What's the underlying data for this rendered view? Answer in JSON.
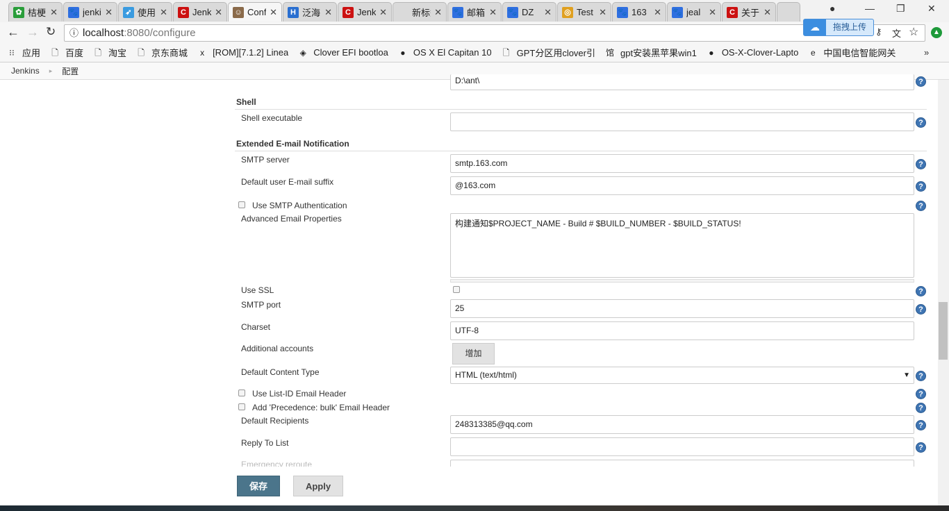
{
  "browser": {
    "tabs": [
      {
        "title": "桔梗",
        "color": "#2a9d3a",
        "glyph": "✿"
      },
      {
        "title": "jenkins",
        "color": "#2f6fe0",
        "glyph": "🐾"
      },
      {
        "title": "使用",
        "color": "#3a9be0",
        "glyph": "➶"
      },
      {
        "title": "Jenkins",
        "color": "#cc1111",
        "glyph": "C"
      },
      {
        "title": "Configure",
        "color": "#8a6a4a",
        "glyph": "☺",
        "active": true
      },
      {
        "title": "泛海",
        "color": "#2a6fd0",
        "glyph": "H"
      },
      {
        "title": "Jenkins",
        "color": "#cc1111",
        "glyph": "C"
      },
      {
        "title": "新标签页",
        "color": "",
        "glyph": ""
      },
      {
        "title": "邮箱",
        "color": "#2f6fe0",
        "glyph": "🐾"
      },
      {
        "title": "DZ",
        "color": "#2f6fe0",
        "glyph": "🐾"
      },
      {
        "title": "Test",
        "color": "#e0a020",
        "glyph": "◎"
      },
      {
        "title": "163",
        "color": "#2f6fe0",
        "glyph": "🐾"
      },
      {
        "title": "jeal",
        "color": "#2f6fe0",
        "glyph": "🐾"
      },
      {
        "title": "关于",
        "color": "#cc1111",
        "glyph": "C"
      }
    ],
    "url_host": "localhost",
    "url_rest": ":8080/configure",
    "baidu_upload": "拖拽上传",
    "bookmarks": [
      {
        "label": "应用",
        "icon": "apps-icon"
      },
      {
        "label": "百度",
        "icon": "page-icon"
      },
      {
        "label": "淘宝",
        "icon": "page-icon"
      },
      {
        "label": "京东商城",
        "icon": "page-icon"
      },
      {
        "label": "[ROM][7.1.2] Linea",
        "icon": "xda-icon"
      },
      {
        "label": "Clover EFI bootloa",
        "icon": "clover-icon"
      },
      {
        "label": "OS X El Capitan 10",
        "icon": "apple-icon"
      },
      {
        "label": "GPT分区用clover引",
        "icon": "page-icon"
      },
      {
        "label": "gpt安装黑苹果win1",
        "icon": "guan-icon"
      },
      {
        "label": "OS-X-Clover-Lapto",
        "icon": "github-icon"
      },
      {
        "label": "中国电信智能网关",
        "icon": "telecom-icon"
      }
    ],
    "bookmarks_more": "»"
  },
  "breadcrumb": [
    "Jenkins",
    "配置"
  ],
  "form": {
    "partial_value": "D:\\ant\\",
    "shell_header": "Shell",
    "shell_label": "Shell executable",
    "shell_value": "",
    "email_header": "Extended E-mail Notification",
    "smtp_server_label": "SMTP server",
    "smtp_server": "smtp.163.com",
    "suffix_label": "Default user E-mail suffix",
    "suffix": "@163.com",
    "smtp_auth_label": "Use SMTP Authentication",
    "smtp_auth": false,
    "adv_label": "Advanced Email Properties",
    "adv_value": "构建通知$PROJECT_NAME - Build # $BUILD_NUMBER - $BUILD_STATUS!",
    "ssl_label": "Use SSL",
    "ssl": false,
    "port_label": "SMTP port",
    "port": "25",
    "charset_label": "Charset",
    "charset": "UTF-8",
    "accounts_label": "Additional accounts",
    "add_button": "增加",
    "content_type_label": "Default Content Type",
    "content_type": "HTML (text/html)",
    "listid_label": "Use List-ID Email Header",
    "listid": false,
    "precedence_label": "Add 'Precedence: bulk' Email Header",
    "precedence": false,
    "recipients_label": "Default Recipients",
    "recipients": "248313385@qq.com",
    "reply_label": "Reply To List",
    "reply": "",
    "emergency_label": "Emergency reroute"
  },
  "footer": {
    "save": "保存",
    "apply": "Apply"
  },
  "colors": {
    "save_bg": "#4b758b",
    "help": "#3f75b3"
  }
}
